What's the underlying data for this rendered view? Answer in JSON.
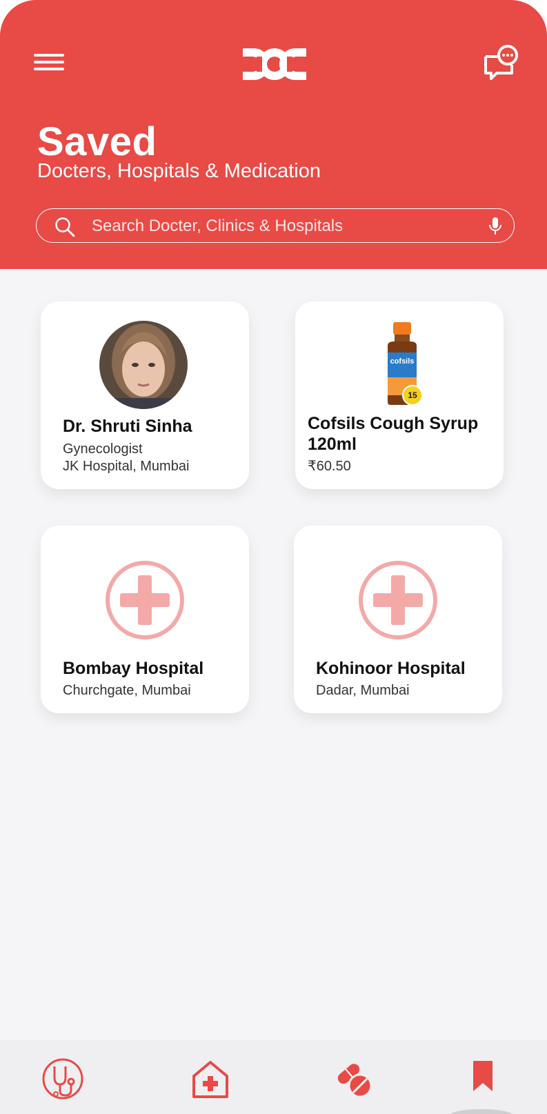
{
  "header": {
    "title": "Saved",
    "subtitle": "Docters, Hospitals & Medication",
    "accent_color": "#e84a46",
    "menu_icon": "hamburger-menu-icon",
    "logo_icon": "doc-logo-icon",
    "chat_icon": "chat-notification-icon"
  },
  "search": {
    "placeholder": "Search Docter, Clinics & Hospitals",
    "value": "",
    "search_icon": "search-icon",
    "mic_icon": "microphone-icon"
  },
  "saved_items": [
    {
      "type": "doctor",
      "name": "Dr. Shruti Sinha",
      "specialty": "Gynecologist",
      "location": "JK Hospital, Mumbai",
      "image_icon": "doctor-avatar"
    },
    {
      "type": "medication",
      "name": "Cofsils Cough Syrup 120ml",
      "price": "₹60.50",
      "image_icon": "cough-syrup-bottle",
      "bottle_label": "cofsils",
      "badge": "15"
    },
    {
      "type": "hospital",
      "name": "Bombay Hospital",
      "location": "Churchgate, Mumbai",
      "image_icon": "hospital-cross-icon"
    },
    {
      "type": "hospital",
      "name": "Kohinoor Hospital",
      "location": "Dadar, Mumbai",
      "image_icon": "hospital-cross-icon"
    }
  ],
  "bottom_nav": {
    "items": [
      {
        "icon": "stethoscope-icon",
        "active": false
      },
      {
        "icon": "hospital-house-icon",
        "active": false
      },
      {
        "icon": "pills-icon",
        "active": false
      },
      {
        "icon": "bookmark-icon",
        "active": true
      }
    ]
  }
}
